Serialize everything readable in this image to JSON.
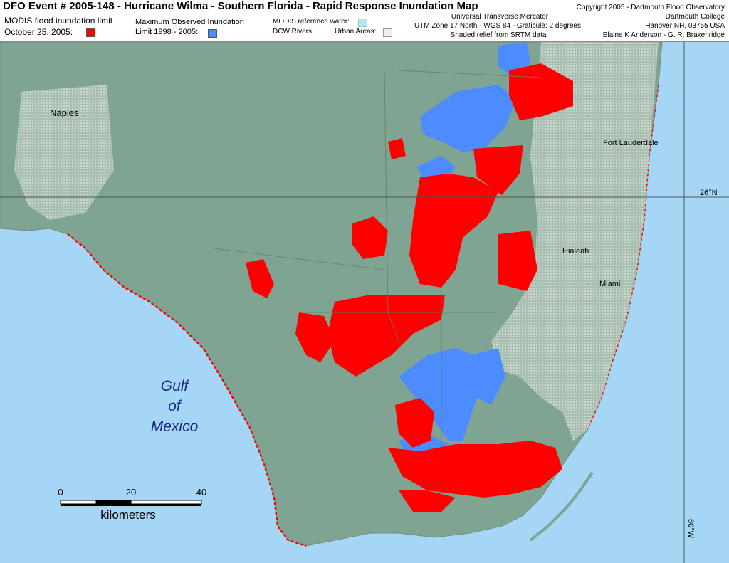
{
  "header": {
    "title": "DFO Event # 2005-148 - Hurricane Wilma - Southern Florida - Rapid Response Inundation Map",
    "legend_flood_line1": "MODIS flood inundation limit",
    "legend_flood_line2": "October 25, 2005:",
    "legend_max_line1": "Maximum Observed Inundation",
    "legend_max_line2": "Limit 1998 - 2005:",
    "legend_ref_water": "MODIS reference water:",
    "legend_rivers": "DCW Rivers:",
    "legend_urban": "Urban Areas:",
    "projection_line1": "Universal Transverse Mercator",
    "projection_line2": "UTM Zone 17 North - WGS 84 - Graticule:  2 degrees",
    "projection_line3": "Shaded relief from SRTM data",
    "credit_line1": "Copyright 2005 - Dartmouth Flood Observatory",
    "credit_line2": "Dartmouth College",
    "credit_line3": "Hanover NH,  03755  USA",
    "credit_line4": "Elaine K Anderson - G. R. Brakenridge"
  },
  "colors": {
    "flood_current": "#ff0000",
    "flood_max": "#4d8cff",
    "reference_water": "#b8e4f5",
    "ocean": "#a5d6f5",
    "land": "#7fa592"
  },
  "map": {
    "cities": [
      "Naples",
      "Fort Lauderdale",
      "Hialeah",
      "Miami"
    ],
    "graticule_lat": "26°N",
    "graticule_lon": "80°W",
    "water_label_line1": "Gulf",
    "water_label_line2": "of",
    "water_label_line3": "Mexico"
  },
  "scalebar": {
    "ticks": [
      "0",
      "20",
      "40"
    ],
    "unit": "kilometers"
  }
}
